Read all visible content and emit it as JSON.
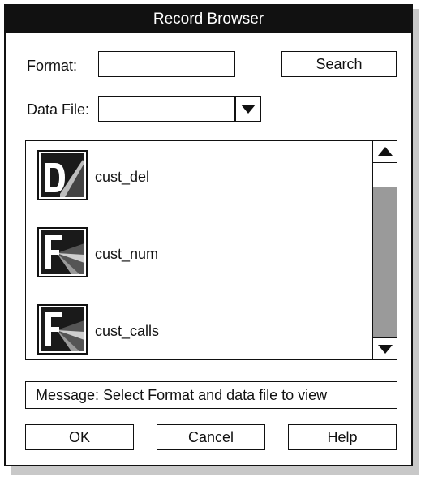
{
  "window": {
    "title": "Record Browser"
  },
  "form": {
    "format_label": "Format:",
    "format_value": "",
    "search_label": "Search",
    "datafile_label": "Data File:",
    "datafile_value": ""
  },
  "records": [
    {
      "label": "cust_del",
      "icon": "d-document-icon"
    },
    {
      "label": "cust_num",
      "icon": "f-document-icon"
    },
    {
      "label": "cust_calls",
      "icon": "f-document-icon"
    }
  ],
  "message": {
    "text": "Message: Select Format and data file to view"
  },
  "footer": {
    "ok_label": "OK",
    "cancel_label": "Cancel",
    "help_label": "Help"
  },
  "colors": {
    "frame": "#111111",
    "scroll_track": "#9a9a9a",
    "shadow": "#c8c8c8"
  }
}
